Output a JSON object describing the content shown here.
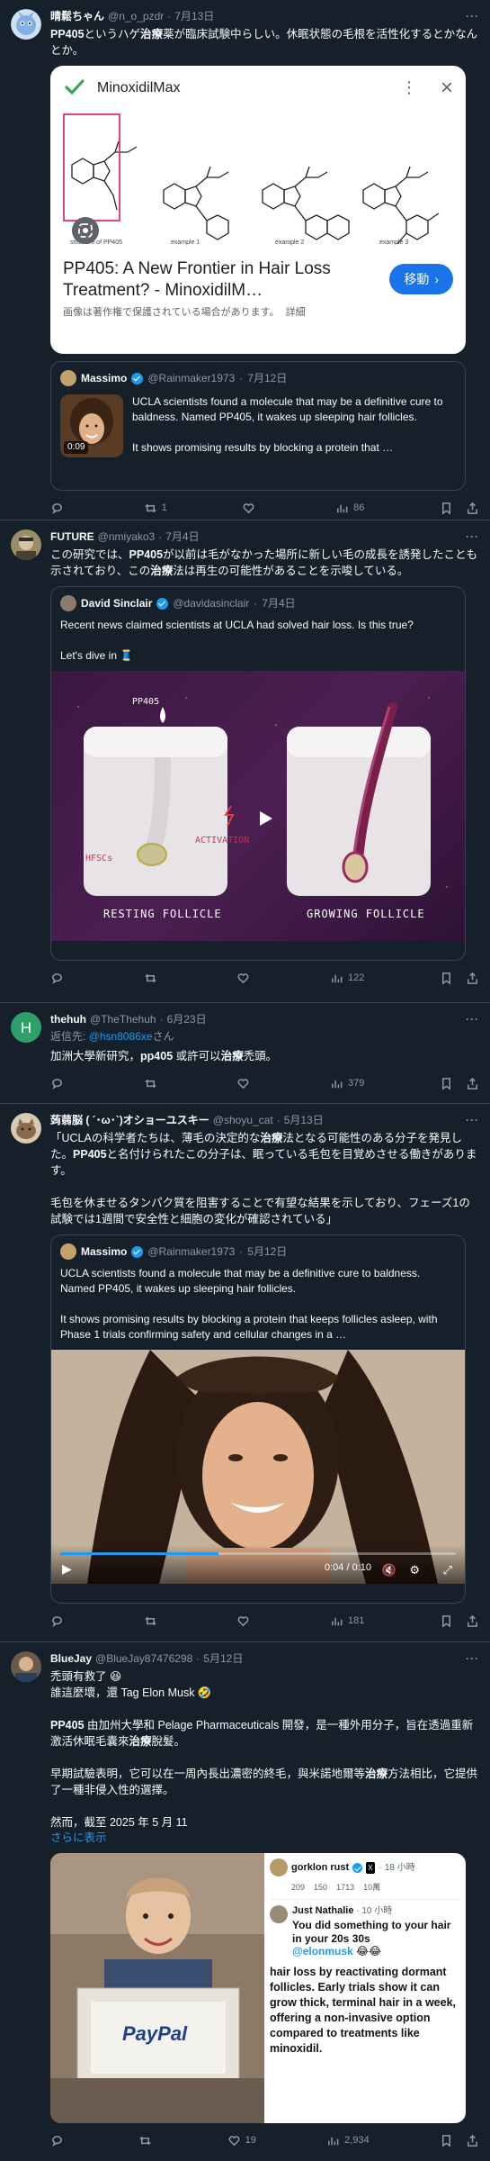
{
  "tweets": [
    {
      "name": "晴鬆ちゃん",
      "handle": "@n_o_pzdr",
      "date": "7月13日",
      "text_parts": [
        "PP405",
        "というハゲ",
        "治療",
        "薬が臨床試験中らしい。休眠状態の毛根を活性化するとかなんとか。"
      ],
      "card": {
        "app_title": "MinoxidilMax",
        "img_captions": [
          "structure of PP405",
          "example 1",
          "example 2",
          "example 3"
        ],
        "title": "PP405: A New Frontier in Hair Loss Treatment? - MinoxidilM…",
        "go_button": "移動",
        "notice": "画像は著作権で保護されている場合があります。",
        "notice_link": "詳細"
      },
      "quote": {
        "name": "Massimo",
        "handle": "@Rainmaker1973",
        "date": "7月12日",
        "video_time": "0:09",
        "text1": "UCLA scientists found a molecule that may be a definitive cure to baldness. Named PP405, it wakes up sleeping hair follicles.",
        "text2": "It shows promising results by blocking a protein that …"
      },
      "actions": {
        "reply": "",
        "retweet": "1",
        "like": "",
        "views": "86"
      }
    },
    {
      "name": "FUTURE",
      "handle": "@nmiyako3",
      "date": "7月4日",
      "text_parts": [
        "この研究では、",
        "PP405",
        "が以前は毛がなかった場所に新しい毛の成長を誘発したことも示されており、この",
        "治療",
        "法は再生の可能性があることを示唆している。"
      ],
      "quote": {
        "name": "David Sinclair",
        "handle": "@davidasinclair",
        "date": "7月4日",
        "text1": "Recent news claimed scientists at UCLA had solved hair loss. Is this true?",
        "text2": "Let's dive in 🧵",
        "diagram": {
          "pp405": "PP405",
          "hfscs": "HFSCs",
          "activation": "ACTIVATION",
          "resting": "RESTING FOLLICLE",
          "growing": "GROWING FOLLICLE"
        }
      },
      "actions": {
        "reply": "",
        "retweet": "",
        "like": "",
        "views": "122"
      }
    },
    {
      "name": "thehuh",
      "handle": "@TheThehuh",
      "date": "6月23日",
      "avatar_letter": "H",
      "reply_to_prefix": "返信先: ",
      "reply_to_handle": "@hsn8086xe",
      "reply_to_suffix": "さん",
      "text_parts": [
        "加洲大學新研究，",
        "pp405",
        " 或許可以",
        "治療",
        "禿頭。"
      ],
      "actions": {
        "reply": "",
        "retweet": "",
        "like": "",
        "views": "379"
      }
    },
    {
      "name": "蒟蒻脳 ( ´･ω･`)オショーユスキー",
      "handle": "@shoyu_cat",
      "date": "5月13日",
      "text_parts": [
        "「UCLAの科学者たちは、薄毛の決定的な",
        "治療",
        "法となる可能性のある分子を発見した。",
        "PP405",
        "と名付けられたこの分子は、眠っている毛包を目覚めさせる働きがあります。"
      ],
      "text_para2": "毛包を休ませるタンパク質を阻害することで有望な結果を示しており、フェーズ1の試験では1週間で安全性と細胞の変化が確認されている」",
      "quote": {
        "name": "Massimo",
        "handle": "@Rainmaker1973",
        "date": "5月12日",
        "text1": "UCLA scientists found a molecule that may be a definitive cure to baldness. Named PP405, it wakes up sleeping hair follicles.",
        "text2": "It shows promising results by blocking a protein that keeps follicles asleep, with Phase 1 trials confirming safety and cellular changes in a …",
        "video_time": "0:04 / 0:10"
      },
      "actions": {
        "reply": "",
        "retweet": "",
        "like": "",
        "views": "181"
      }
    },
    {
      "name": "BlueJay",
      "handle": "@BlueJay87476298",
      "date": "5月12日",
      "line1": "禿頭有救了 😆",
      "line2": "誰這麼壞，還 Tag Elon Musk 🤣",
      "para1_parts": [
        "PP405",
        " 由加州大學和 Pelage Pharmaceuticals 開發，是一種外用分子，旨在透過重新激活休眠毛囊來",
        "治療",
        "脫髮。"
      ],
      "para2_parts": [
        "早期試驗表明，它可以在一周內長出濃密的終毛，與米諾地爾等",
        "治療",
        "方法相比，它提供了一種非侵入性的選擇。"
      ],
      "para3": "然而，截至 2025 年 5 月 11",
      "show_more": "さらに表示",
      "image": {
        "paypal": "PayPal",
        "s_name": "gorklon rust",
        "s_time": "18 小時",
        "s_counts": [
          "209",
          "150",
          "1713",
          "10萬"
        ],
        "s2_name": "Just Nathalie",
        "s2_time": "10 小時",
        "s2_text": "You did something to your hair in your 20s 30s",
        "s2_mention": "@elonmusk",
        "s2_emoji": "😂😂",
        "s3_text": "hair loss by reactivating dormant follicles. Early trials show it can grow thick, terminal hair in a week, offering a non-invasive option compared to treatments like minoxidil."
      },
      "actions": {
        "reply": "",
        "retweet": "",
        "like": "19",
        "views": "2,934"
      }
    }
  ],
  "colors": {
    "bg": "#15202b",
    "border": "#38444d",
    "text": "#f7f9f9",
    "muted": "#8b98a5",
    "accent": "#1d9bf0"
  },
  "icons": [
    "reply-icon",
    "retweet-icon",
    "like-icon",
    "views-icon",
    "bookmark-icon",
    "share-icon",
    "verified-icon",
    "more-icon"
  ]
}
